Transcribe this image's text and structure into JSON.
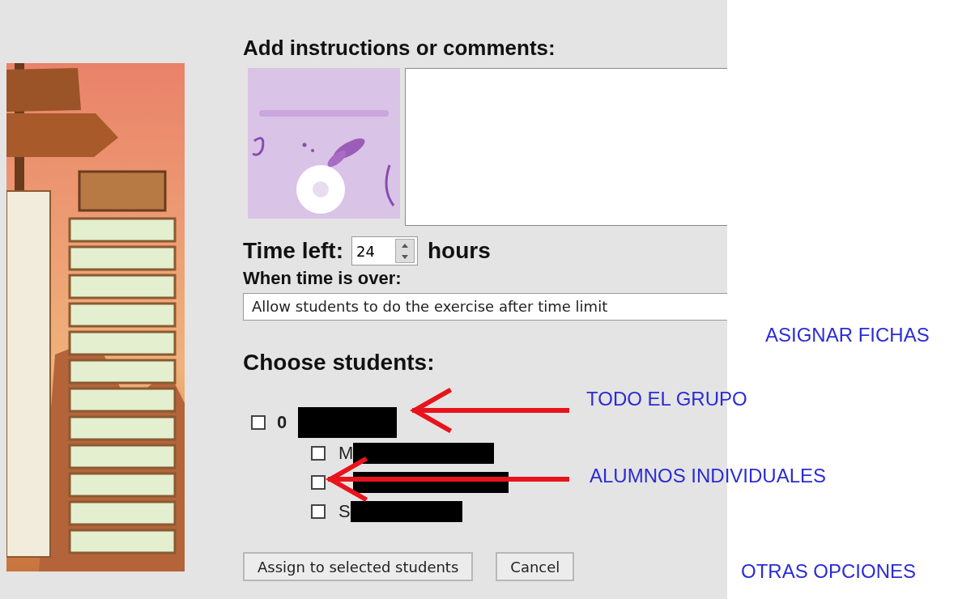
{
  "instructions": {
    "heading": "Add instructions or comments:"
  },
  "time_left": {
    "label": "Time left:",
    "value": "24",
    "unit": "hours"
  },
  "when_over": {
    "label": "When time is over:",
    "value": "Allow students to do the exercise after time limit"
  },
  "students": {
    "heading": "Choose students:",
    "groups": [
      {
        "label": "0",
        "checked": false,
        "redacted": true,
        "children": [
          {
            "label": "M",
            "checked": false,
            "redacted": true
          },
          {
            "checked": false,
            "redacted": true
          },
          {
            "label": "S",
            "checked": false,
            "redacted": true
          }
        ]
      }
    ]
  },
  "buttons": [
    {
      "label": "Assign to selected students"
    },
    {
      "label": "Cancel"
    }
  ],
  "annotations": [
    {
      "text": "ASIGNAR FICHAS",
      "arrow": false
    },
    {
      "text": "TODO EL GRUPO",
      "arrow": true
    },
    {
      "text": "ALUMNOS INDIVIDUALES",
      "arrow": true
    },
    {
      "text": "OTRAS OPCIONES",
      "arrow": false
    }
  ]
}
